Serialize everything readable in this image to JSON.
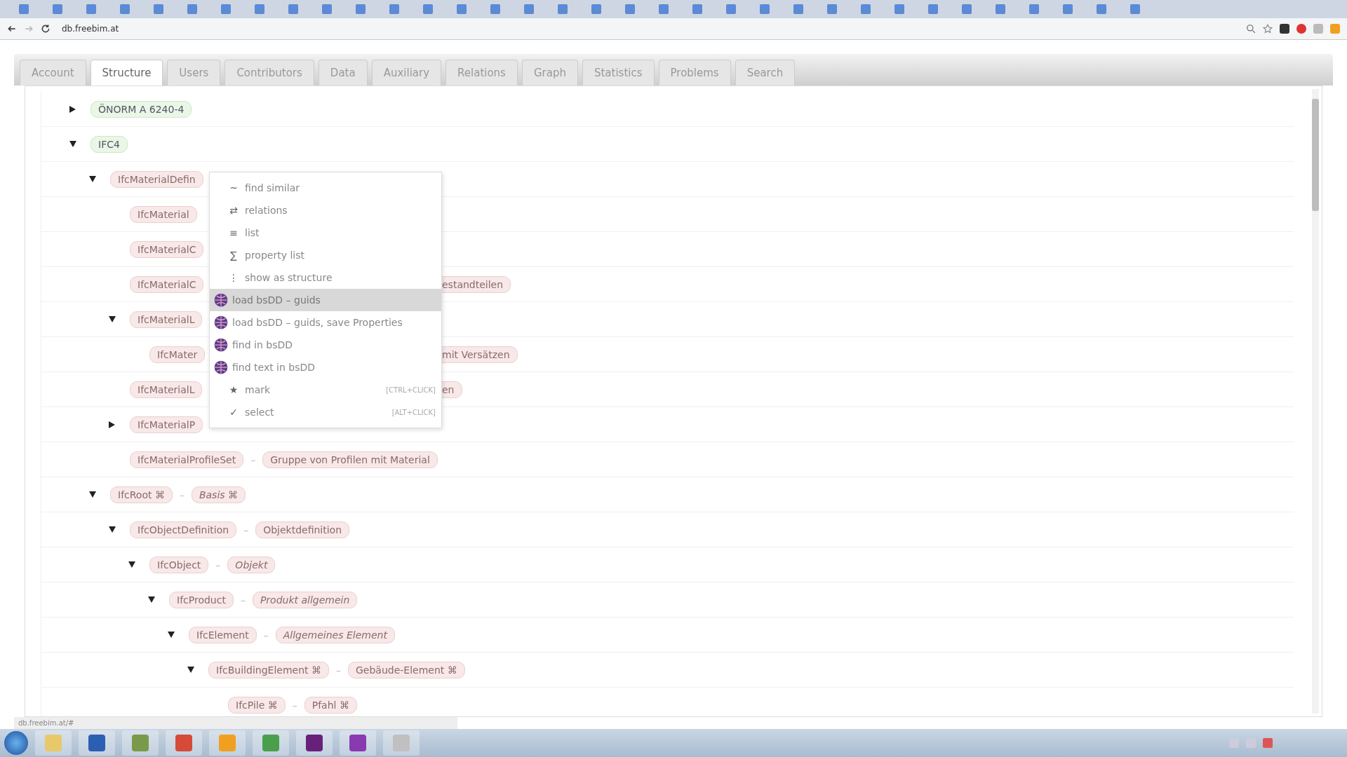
{
  "browser": {
    "address": "db.freebim.at",
    "status": "db.freebim.at/#"
  },
  "tabs": [
    {
      "label": "Account",
      "selected": false
    },
    {
      "label": "Structure",
      "selected": true
    },
    {
      "label": "Users",
      "selected": false
    },
    {
      "label": "Contributors",
      "selected": false
    },
    {
      "label": "Data",
      "selected": false
    },
    {
      "label": "Auxiliary",
      "selected": false
    },
    {
      "label": "Relations",
      "selected": false
    },
    {
      "label": "Graph",
      "selected": false
    },
    {
      "label": "Statistics",
      "selected": false
    },
    {
      "label": "Problems",
      "selected": false
    },
    {
      "label": "Search",
      "selected": false
    }
  ],
  "tree": [
    {
      "name": "ÖNORM A 6240-4",
      "kind": "standard",
      "expanded": false
    },
    {
      "name": "IFC4",
      "kind": "standard",
      "expanded": true,
      "children": [
        {
          "name": "IfcMaterialDefin",
          "kind": "class",
          "expanded": true,
          "children": [
            {
              "name": "IfcMaterial",
              "kind": "class"
            },
            {
              "name": "IfcMaterialC",
              "kind": "class"
            },
            {
              "name": "IfcMaterialC",
              "kind": "class",
              "tail": "estandteilen"
            },
            {
              "name": "IfcMaterialL",
              "kind": "class",
              "expanded": true,
              "children": [
                {
                  "name": "IfcMater",
                  "kind": "class",
                  "tail": "mit Versätzen"
                }
              ]
            },
            {
              "name": "IfcMaterialL",
              "kind": "class",
              "tail": "en"
            },
            {
              "name": "IfcMaterialP",
              "kind": "class",
              "expanded": false
            },
            {
              "name": "IfcMaterialProfileSet",
              "kind": "class",
              "separator": "–",
              "desc": "Gruppe von Profilen mit Material",
              "italic": false
            }
          ]
        },
        {
          "name": "IfcRoot ⌘",
          "kind": "class",
          "separator": "–",
          "desc": "Basis ⌘",
          "italic": true,
          "expanded": true,
          "children": [
            {
              "name": "IfcObjectDefinition",
              "kind": "class",
              "separator": "–",
              "desc": "Objektdefinition",
              "italic": false,
              "expanded": true,
              "children": [
                {
                  "name": "IfcObject",
                  "kind": "class",
                  "separator": "–",
                  "desc": "Objekt",
                  "italic": true,
                  "expanded": true,
                  "children": [
                    {
                      "name": "IfcProduct",
                      "kind": "class",
                      "separator": "–",
                      "desc": "Produkt allgemein",
                      "italic": true,
                      "expanded": true,
                      "children": [
                        {
                          "name": "IfcElement",
                          "kind": "class",
                          "separator": "–",
                          "desc": "Allgemeines Element",
                          "italic": true,
                          "expanded": true,
                          "children": [
                            {
                              "name": "IfcBuildingElement ⌘",
                              "kind": "class",
                              "separator": "–",
                              "desc": "Gebäude-Element ⌘",
                              "italic": false,
                              "expanded": true,
                              "children": [
                                {
                                  "name": "IfcPile ⌘",
                                  "kind": "class",
                                  "separator": "–",
                                  "desc": "Pfahl ⌘",
                                  "italic": false
                                }
                              ]
                            }
                          ]
                        }
                      ]
                    }
                  ]
                }
              ]
            }
          ]
        }
      ]
    }
  ],
  "context_menu": [
    {
      "icon": "~",
      "label": "find similar",
      "kind": "glyph",
      "selected": false
    },
    {
      "icon": "⇄",
      "label": "relations",
      "kind": "glyph",
      "selected": false
    },
    {
      "icon": "≡",
      "label": "list",
      "kind": "glyph",
      "selected": false
    },
    {
      "icon": "∑",
      "label": "property list",
      "kind": "glyph",
      "selected": false
    },
    {
      "icon": "⋮",
      "label": "show as structure",
      "kind": "glyph",
      "selected": false
    },
    {
      "label": "load bsDD – guids",
      "kind": "bsdd",
      "selected": true
    },
    {
      "label": "load bsDD – guids, save Properties",
      "kind": "bsdd",
      "selected": false
    },
    {
      "label": "find in bsDD",
      "kind": "bsdd",
      "selected": false
    },
    {
      "label": "find text in bsDD",
      "kind": "bsdd",
      "selected": false
    },
    {
      "icon": "★",
      "label": "mark",
      "shortcut": "[CTRL+CLICK]",
      "kind": "glyph",
      "selected": false
    },
    {
      "icon": "✓",
      "label": "select",
      "shortcut": "[ALT+CLICK]",
      "kind": "glyph",
      "selected": false
    }
  ]
}
